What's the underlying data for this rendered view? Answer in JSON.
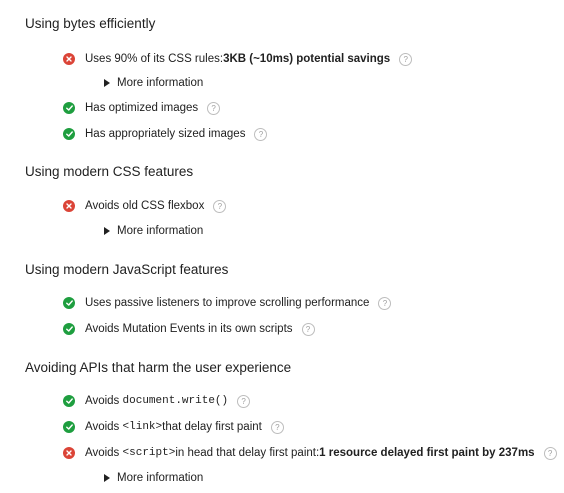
{
  "sections": [
    {
      "title": "Using bytes efficiently",
      "audits": [
        {
          "status": "fail",
          "label": "Uses 90% of its CSS rules: ",
          "savings": "3KB (~10ms) potential savings",
          "more_info": "More information"
        },
        {
          "status": "pass",
          "label": "Has optimized images"
        },
        {
          "status": "pass",
          "label": "Has appropriately sized images"
        }
      ]
    },
    {
      "title": "Using modern CSS features",
      "audits": [
        {
          "status": "fail",
          "label": "Avoids old CSS flexbox",
          "more_info": "More information"
        }
      ]
    },
    {
      "title": "Using modern JavaScript features",
      "audits": [
        {
          "status": "pass",
          "label": "Uses passive listeners to improve scrolling performance"
        },
        {
          "status": "pass",
          "label": "Avoids Mutation Events in its own scripts"
        }
      ]
    },
    {
      "title": "Avoiding APIs that harm the user experience",
      "audits": [
        {
          "status": "pass",
          "label_pre": "Avoids ",
          "code": "document.write()",
          "label_post": ""
        },
        {
          "status": "pass",
          "label_pre": "Avoids ",
          "code": "<link>",
          "label_post": " that delay first paint"
        },
        {
          "status": "fail",
          "label_pre": "Avoids ",
          "code": "<script>",
          "label_post": " in head that delay first paint: ",
          "savings": "1 resource delayed first paint by 237ms",
          "more_info": "More information"
        }
      ]
    }
  ],
  "help_glyph": "?",
  "colors": {
    "pass": "#1e9e3f",
    "fail": "#db4437"
  },
  "icons": {
    "pass": "check-icon",
    "fail": "close-icon",
    "help": "help-icon",
    "expand": "triangle-right-icon"
  }
}
